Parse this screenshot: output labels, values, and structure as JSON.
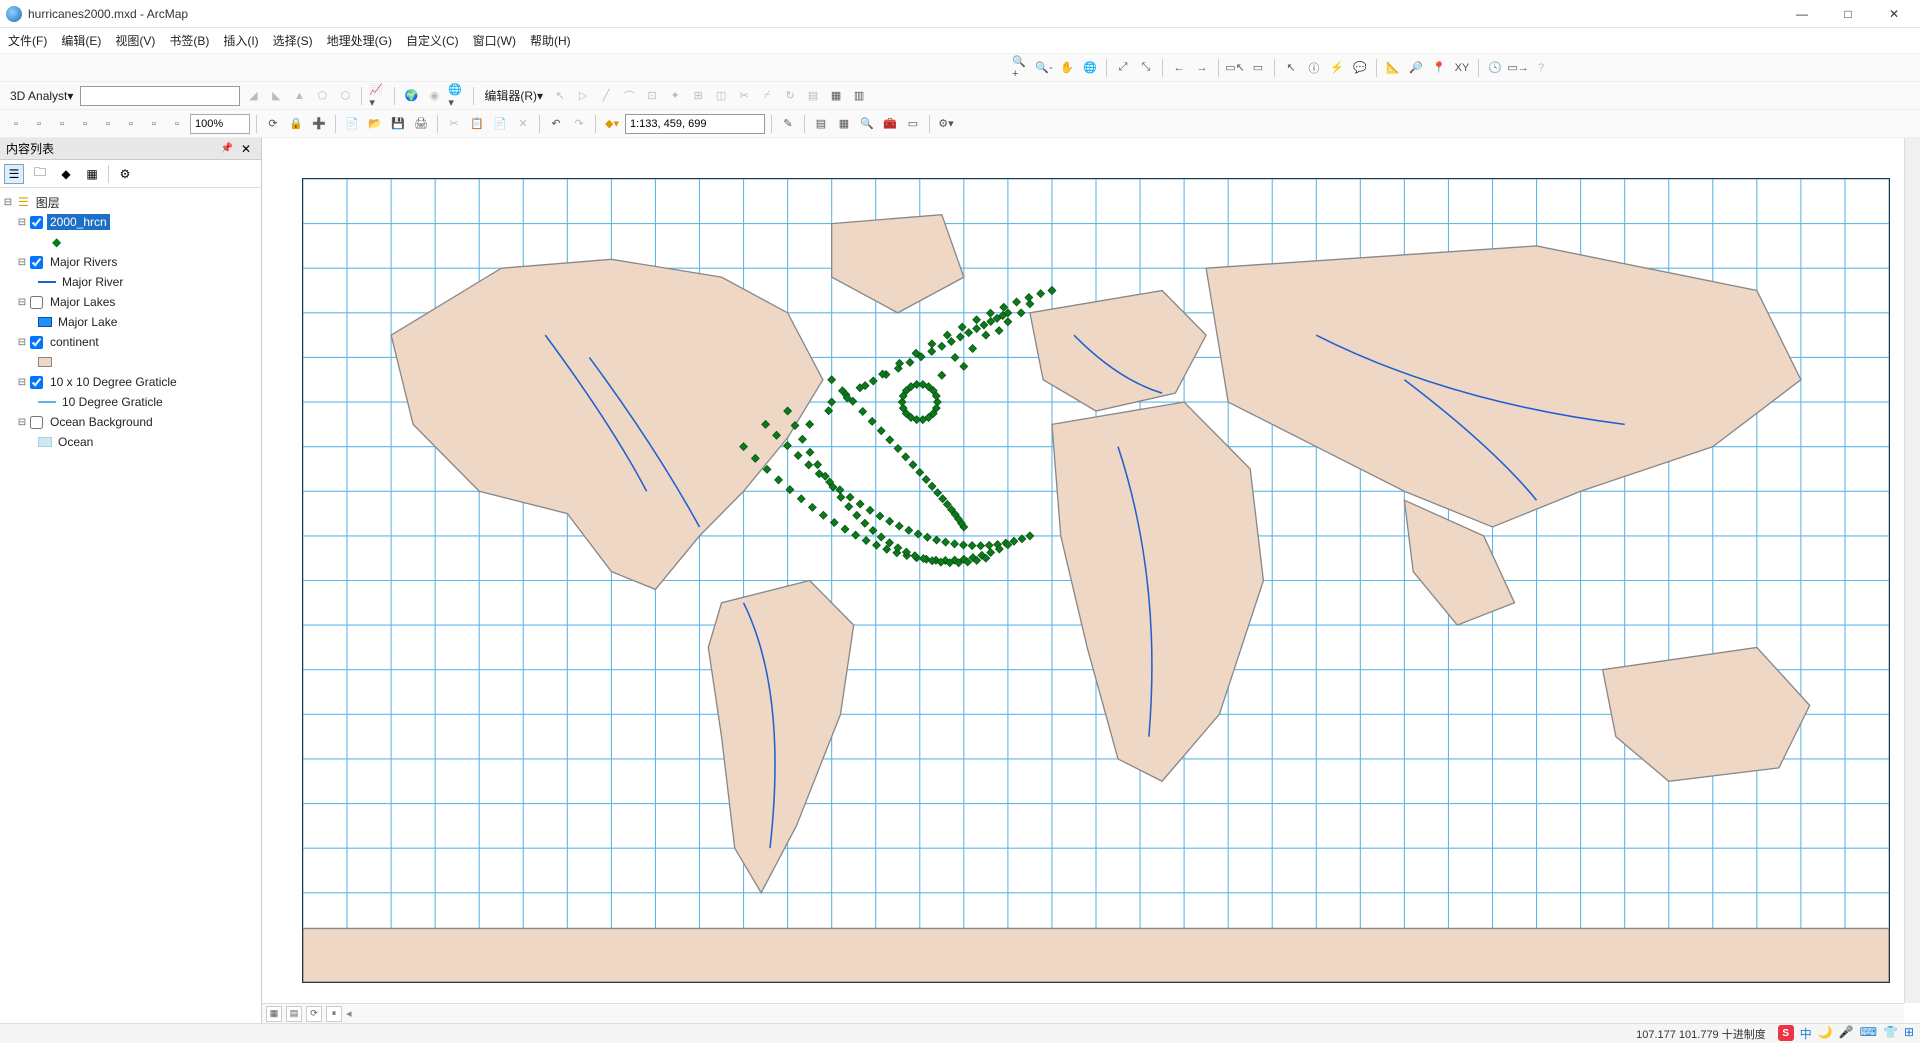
{
  "window": {
    "title": "hurricanes2000.mxd - ArcMap",
    "minimize": "—",
    "maximize": "□",
    "close": "✕"
  },
  "menus": [
    "文件(F)",
    "编辑(E)",
    "视图(V)",
    "书签(B)",
    "插入(I)",
    "选择(S)",
    "地理处理(G)",
    "自定义(C)",
    "窗口(W)",
    "帮助(H)"
  ],
  "toolbar": {
    "analyst_label": "3D Analyst▾",
    "zoom_pct": "100%",
    "editor_label": "编辑器(R)▾",
    "scale": "1:133, 459, 699"
  },
  "toc": {
    "title": "内容列表",
    "root": "图层",
    "layers": [
      {
        "name": "2000_hrcn",
        "checked": true,
        "selected": true,
        "expanded": true,
        "symbol": {
          "type": "diamond",
          "color": "#0a7a1a"
        }
      },
      {
        "name": "Major Rivers",
        "checked": true,
        "expanded": true,
        "children": [
          {
            "label": "Major River",
            "symbol": {
              "type": "line",
              "color": "#1e60d0"
            }
          }
        ]
      },
      {
        "name": "Major Lakes",
        "checked": false,
        "expanded": true,
        "children": [
          {
            "label": "Major Lake",
            "symbol": {
              "type": "box",
              "color": "#1e90ff"
            }
          }
        ]
      },
      {
        "name": "continent",
        "checked": true,
        "expanded": true,
        "children": [
          {
            "label": "",
            "symbol": {
              "type": "box",
              "color": "#efd7c6"
            }
          }
        ]
      },
      {
        "name": "10 x 10 Degree Graticle",
        "checked": true,
        "expanded": true,
        "children": [
          {
            "label": "10 Degree Graticle",
            "symbol": {
              "type": "line",
              "color": "#5fb7e5"
            }
          }
        ]
      },
      {
        "name": "Ocean Background",
        "checked": false,
        "expanded": true,
        "children": [
          {
            "label": "Ocean",
            "symbol": {
              "type": "box",
              "color": "#cfe8f5"
            }
          }
        ]
      }
    ]
  },
  "statusbar": {
    "coords": "107.177  101.779  十进制度",
    "ime": [
      "中",
      "🌙",
      "🎤",
      "⌨",
      "👕",
      "⊞"
    ]
  },
  "colors": {
    "grid": "#5fb7e5",
    "land": "#efd7c6",
    "river": "#1e60d0",
    "hrcn": "#0a7a1a",
    "hrcn_stroke": "#064d10"
  }
}
